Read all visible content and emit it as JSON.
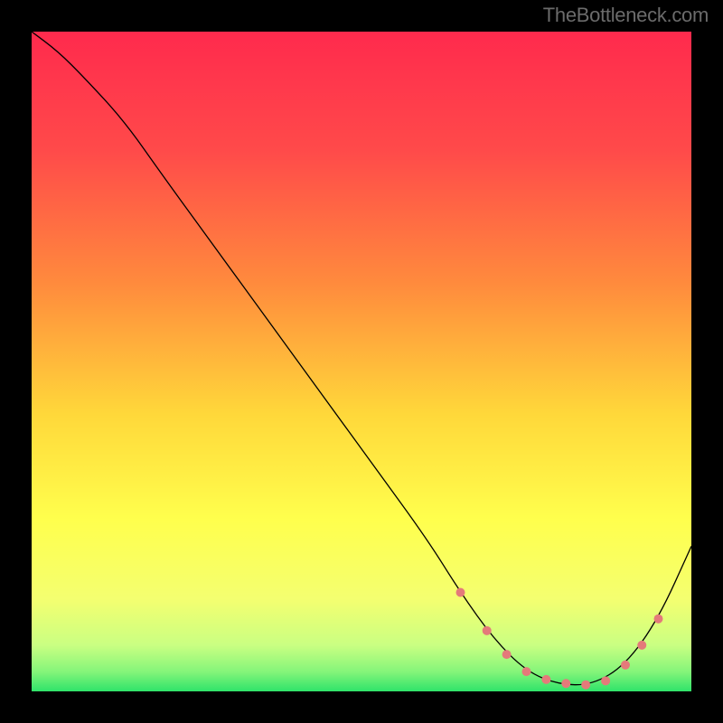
{
  "attribution": "TheBottleneck.com",
  "chart_data": {
    "type": "line",
    "title": "",
    "xlabel": "",
    "ylabel": "",
    "xlim": [
      0,
      100
    ],
    "ylim": [
      0,
      100
    ],
    "grid": false,
    "legend": false,
    "background_gradient_stops": [
      {
        "offset": 0.0,
        "color": "#ff2a4d"
      },
      {
        "offset": 0.18,
        "color": "#ff4a4a"
      },
      {
        "offset": 0.38,
        "color": "#ff8a3d"
      },
      {
        "offset": 0.58,
        "color": "#ffd83a"
      },
      {
        "offset": 0.74,
        "color": "#ffff4d"
      },
      {
        "offset": 0.86,
        "color": "#f4ff70"
      },
      {
        "offset": 0.93,
        "color": "#caff82"
      },
      {
        "offset": 0.97,
        "color": "#85f57a"
      },
      {
        "offset": 1.0,
        "color": "#2fe36a"
      }
    ],
    "series": [
      {
        "name": "bottleneck-curve",
        "color": "#000000",
        "stroke_width": 1.3,
        "x": [
          0,
          4,
          8,
          14,
          20,
          28,
          36,
          44,
          52,
          60,
          65,
          70,
          75,
          80,
          85,
          90,
          95,
          100
        ],
        "values": [
          100,
          97,
          93,
          86.5,
          78,
          67,
          56,
          45,
          34,
          23,
          15,
          8,
          3,
          1,
          1,
          4,
          11,
          22
        ]
      }
    ],
    "markers": {
      "name": "optimal-range-markers",
      "color": "#e47a7a",
      "radius": 5,
      "x": [
        65,
        69,
        72,
        75,
        78,
        81,
        84,
        87,
        90,
        92.5,
        95
      ],
      "values": [
        15,
        9.2,
        5.6,
        3,
        1.8,
        1.2,
        1.0,
        1.6,
        4,
        7,
        11
      ]
    }
  }
}
